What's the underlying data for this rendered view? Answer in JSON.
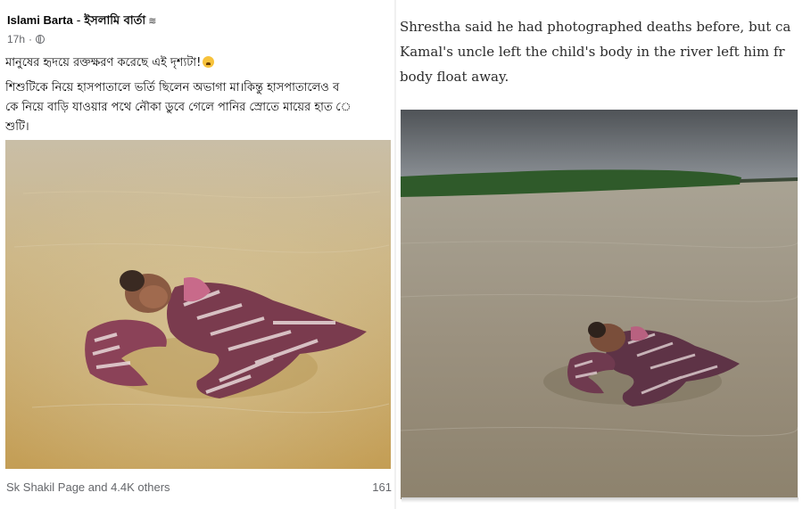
{
  "facebook_post": {
    "page_name": "Islami Barta",
    "separator": "-",
    "page_name_bn": "ইসলামি বার্তা",
    "time": "17h",
    "dot": "·",
    "icons": {
      "verified_wave": "wave-icon",
      "privacy": "globe-icon",
      "emoji": "sad-face-icon"
    },
    "text_lines": [
      "মানুষের হৃদয়ে রক্তক্ষরণ করেছে এই দৃশ্যটা!",
      "শিশুটিকে নিয়ে হাসপাতালে ভর্তি ছিলেন অভাগা মা।কিন্তু হাসপাতালেও ব",
      "কে নিয়ে বাড়ি যাওয়ার পথে নৌকা ডুবে গেলে পানির স্রোতে মায়ের হাত ে",
      "শুটি।"
    ],
    "reactions_text": "Sk Shakil Page and 4.4K others",
    "comment_count": "161"
  },
  "article": {
    "lines": [
      "Shrestha said he had photographed deaths before, but ca",
      "Kamal's uncle left the child's body in the river left him fr",
      "body float away."
    ]
  },
  "colors": {
    "fb_text": "#050505",
    "fb_meta": "#65676b",
    "article_text": "#2b2b2b",
    "water_yellow": "#cdb683",
    "water_grey": "#9a9283",
    "sky": "#5e6266",
    "treeline": "#2f5a2a"
  }
}
